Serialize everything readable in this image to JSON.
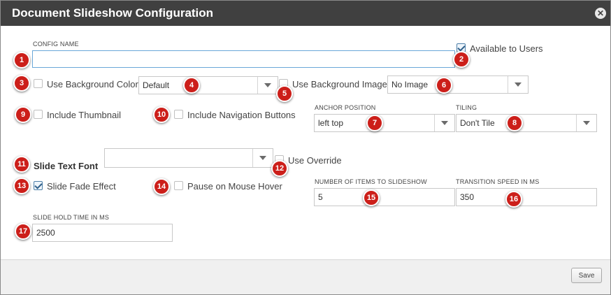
{
  "dialog": {
    "title": "Document Slideshow Configuration",
    "save_label": "Save",
    "close_glyph": "✕"
  },
  "fields": {
    "config_name_label": "CONFIG NAME",
    "config_name_value": "",
    "available_to_users": {
      "label": "Available to Users",
      "checked": true
    },
    "use_background_color": {
      "label": "Use Background Color",
      "checked": false
    },
    "background_color_select": "Default",
    "use_background_image": {
      "label": "Use Background Image",
      "checked": false
    },
    "background_image_select": "No Image",
    "include_thumbnail": {
      "label": "Include Thumbnail",
      "checked": false
    },
    "include_navigation_buttons": {
      "label": "Include Navigation Buttons",
      "checked": false
    },
    "anchor_position_label": "ANCHOR POSITION",
    "anchor_position_value": "left top",
    "tiling_label": "TILING",
    "tiling_value": "Don't Tile",
    "slide_text_font_label": "Slide Text Font",
    "slide_text_font_value": "",
    "use_override": {
      "label": "Use Override",
      "checked": false
    },
    "slide_fade_effect": {
      "label": "Slide Fade Effect",
      "checked": true
    },
    "pause_on_mouse_hover": {
      "label": "Pause on Mouse Hover",
      "checked": false
    },
    "items_to_slideshow_label": "NUMBER OF ITEMS TO SLIDESHOW",
    "items_to_slideshow_value": "5",
    "transition_speed_label": "TRANSITION SPEED IN MS",
    "transition_speed_value": "350",
    "slide_hold_time_label": "SLIDE HOLD TIME IN MS",
    "slide_hold_time_value": "2500"
  },
  "annotations": [
    "1",
    "2",
    "3",
    "4",
    "5",
    "6",
    "7",
    "8",
    "9",
    "10",
    "11",
    "12",
    "13",
    "14",
    "15",
    "16",
    "17"
  ],
  "icons": {
    "close": "close-icon",
    "dropdown": "chevron-down-icon",
    "check": "check-icon"
  },
  "colors": {
    "titlebar": "#404040",
    "badge": "#cc1f1a",
    "focus_border": "#6aa7d8",
    "footer": "#f0f0f0"
  }
}
